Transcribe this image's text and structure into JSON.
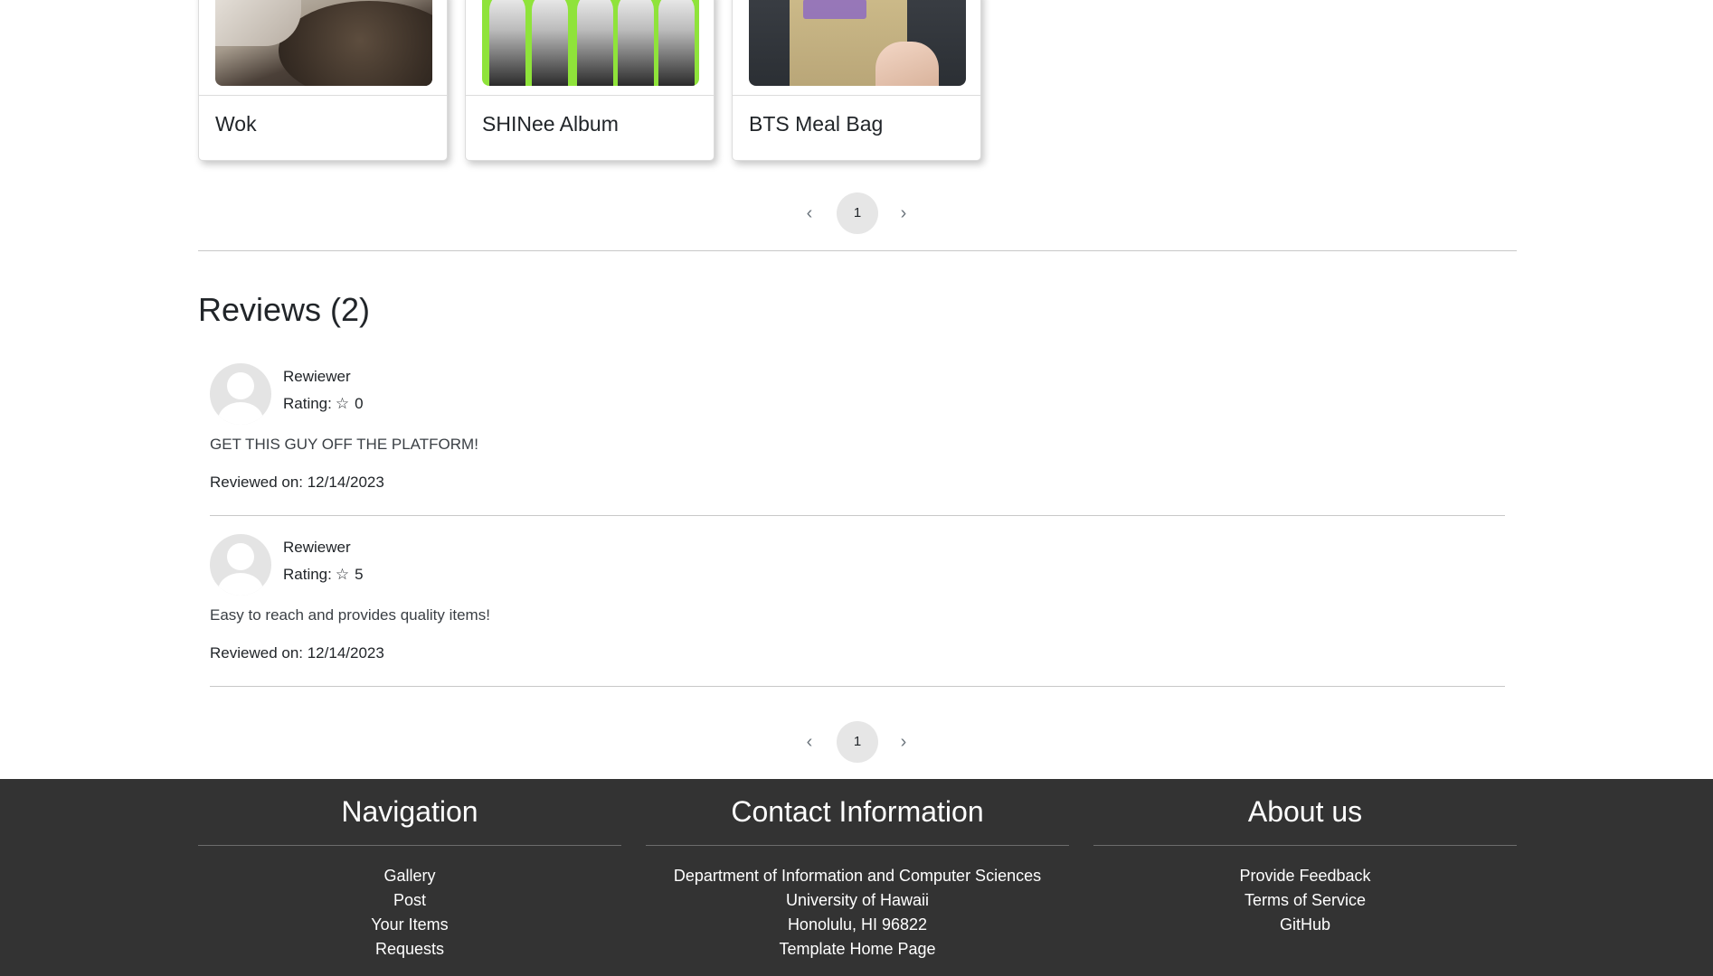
{
  "items": [
    {
      "title": "Wok"
    },
    {
      "title": "SHINee Album"
    },
    {
      "title": "BTS Meal Bag"
    }
  ],
  "items_pager": {
    "prev": "‹",
    "page": "1",
    "next": "›"
  },
  "reviews": {
    "heading": "Reviews (2)",
    "list": [
      {
        "reviewer": "Rewiewer",
        "rating_label": "Rating:",
        "star": "☆",
        "rating": "0",
        "text": "GET THIS GUY OFF THE PLATFORM!",
        "date": "Reviewed on: 12/14/2023"
      },
      {
        "reviewer": "Rewiewer",
        "rating_label": "Rating:",
        "star": "☆",
        "rating": "5",
        "text": "Easy to reach and provides quality items!",
        "date": "Reviewed on: 12/14/2023"
      }
    ]
  },
  "reviews_pager": {
    "prev": "‹",
    "page": "1",
    "next": "›"
  },
  "footer": {
    "navigation": {
      "heading": "Navigation",
      "links": [
        "Gallery",
        "Post",
        "Your Items",
        "Requests"
      ]
    },
    "contact": {
      "heading": "Contact Information",
      "lines": [
        "Department of Information and Computer Sciences",
        "University of Hawaii",
        "Honolulu, HI 96822",
        "Template Home Page"
      ]
    },
    "about": {
      "heading": "About us",
      "links": [
        "Provide Feedback",
        "Terms of Service",
        "GitHub"
      ]
    }
  },
  "colors": {
    "footer_bg": "#333333",
    "pager_active": "#e6e6e6",
    "shinee_green": "#8fe33a"
  }
}
